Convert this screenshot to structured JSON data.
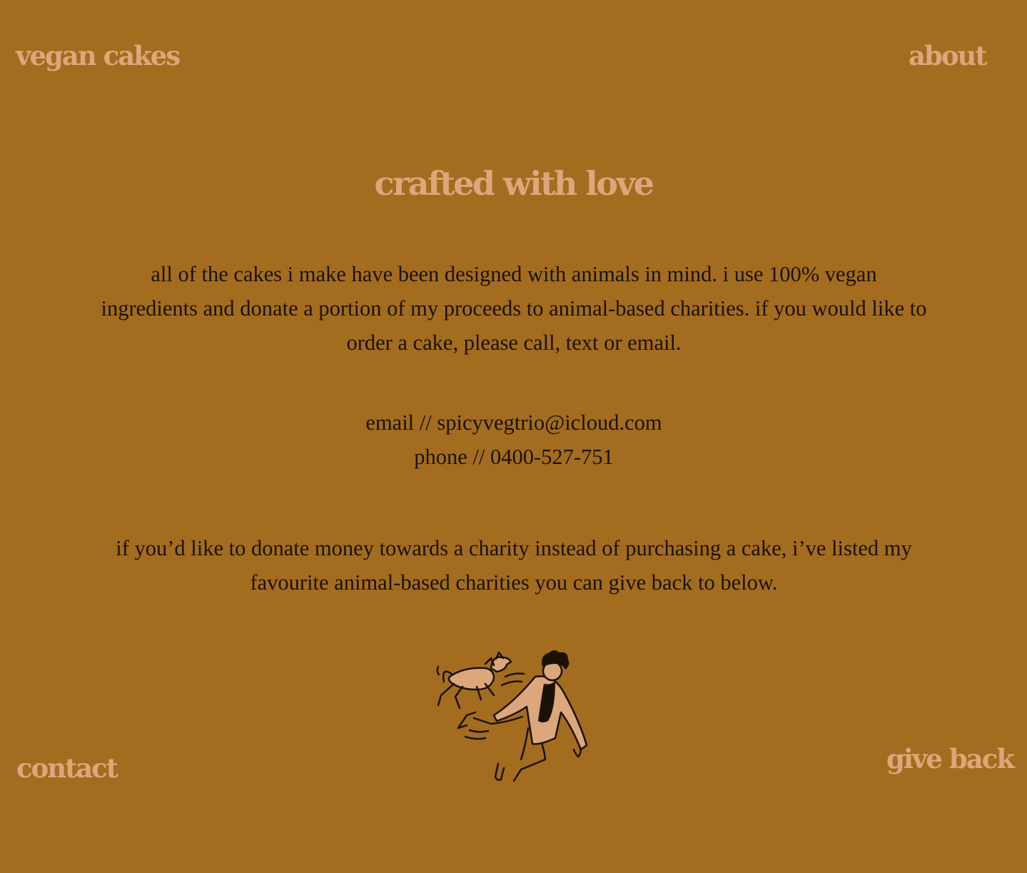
{
  "nav": {
    "top_left": "vegan cakes",
    "top_right": "about",
    "bottom_left": "contact",
    "bottom_right": "give back"
  },
  "main": {
    "headline": "crafted with love",
    "intro": "all of the cakes i make have been designed with animals in mind. i use 100% vegan ingredients and donate a portion of my proceeds to animal-based charities. if you would  like to order a cake, please call, text or email.",
    "email_line": "email // spicyvegtrio@icloud.com",
    "phone_line": "phone // 0400-527-751",
    "donate_text": "if you’d like to donate money towards a charity instead of purchasing a cake, i’ve listed my favourite animal-based charities you can give back to below."
  },
  "colors": {
    "background": "#a46c1f",
    "accent": "#dca77a",
    "body_text": "#1a1208"
  },
  "illustration": {
    "icon": "person-running-with-dog-illustration"
  }
}
